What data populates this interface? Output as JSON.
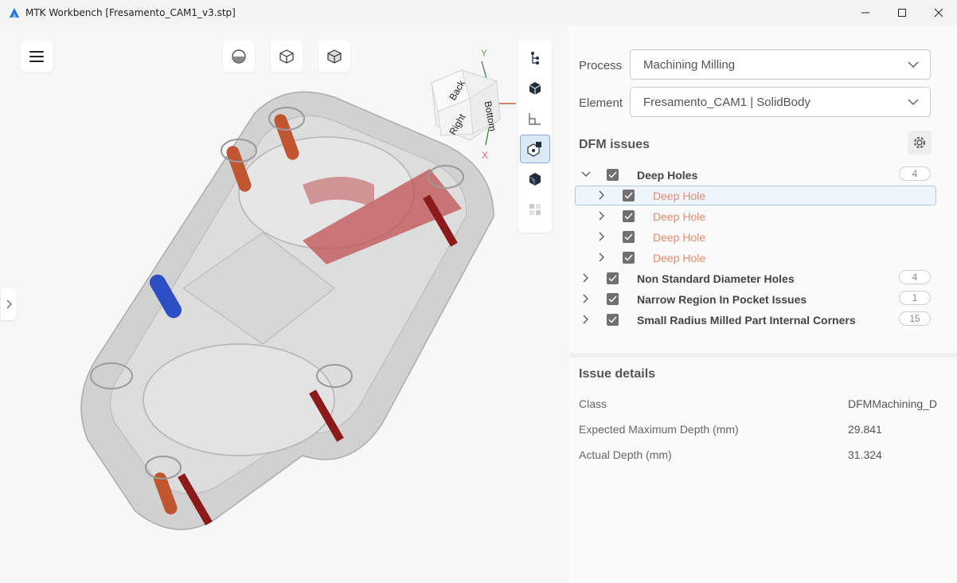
{
  "window": {
    "title": "MTK Workbench [Fresamento_CAM1_v3.stp]",
    "controls": [
      "minimize",
      "maximize",
      "close"
    ]
  },
  "viewport": {
    "axes": {
      "y": "Y",
      "x": "X"
    },
    "view_cube": {
      "faces": [
        "Back",
        "Bottom",
        "Right"
      ]
    },
    "top_buttons": [
      "shading-icon",
      "wireframe-cube-icon",
      "solid-cube-icon"
    ],
    "side_tools": [
      "tree-icon",
      "cube-icon",
      "layout-icon",
      "explode-icon",
      "box-icon",
      "grid-icon"
    ]
  },
  "panel": {
    "process_label": "Process",
    "process_value": "Machining Milling",
    "element_label": "Element",
    "element_value": "Fresamento_CAM1 | SolidBody",
    "dfm_title": "DFM issues",
    "issues": [
      {
        "label": "Deep Holes",
        "count": "4",
        "expanded": true,
        "level": 0
      },
      {
        "label": "Deep Hole",
        "level": 1,
        "selected": true
      },
      {
        "label": "Deep Hole",
        "level": 1
      },
      {
        "label": "Deep Hole",
        "level": 1
      },
      {
        "label": "Deep Hole",
        "level": 1
      },
      {
        "label": "Non Standard Diameter Holes",
        "count": "4",
        "level": 0
      },
      {
        "label": "Narrow Region In Pocket Issues",
        "count": "1",
        "level": 0
      },
      {
        "label": "Small Radius Milled Part Internal Corners",
        "count": "15",
        "level": 0
      }
    ],
    "details_title": "Issue details",
    "details": [
      {
        "label": "Class",
        "value": "DFMMachining_D"
      },
      {
        "label": "Expected Maximum Depth (mm)",
        "value": "29.841"
      },
      {
        "label": "Actual Depth (mm)",
        "value": "31.324"
      }
    ]
  },
  "colors": {
    "accent": "#1e6fd9",
    "issue_child": "#e88a6a",
    "highlight_red": "#b22222"
  }
}
